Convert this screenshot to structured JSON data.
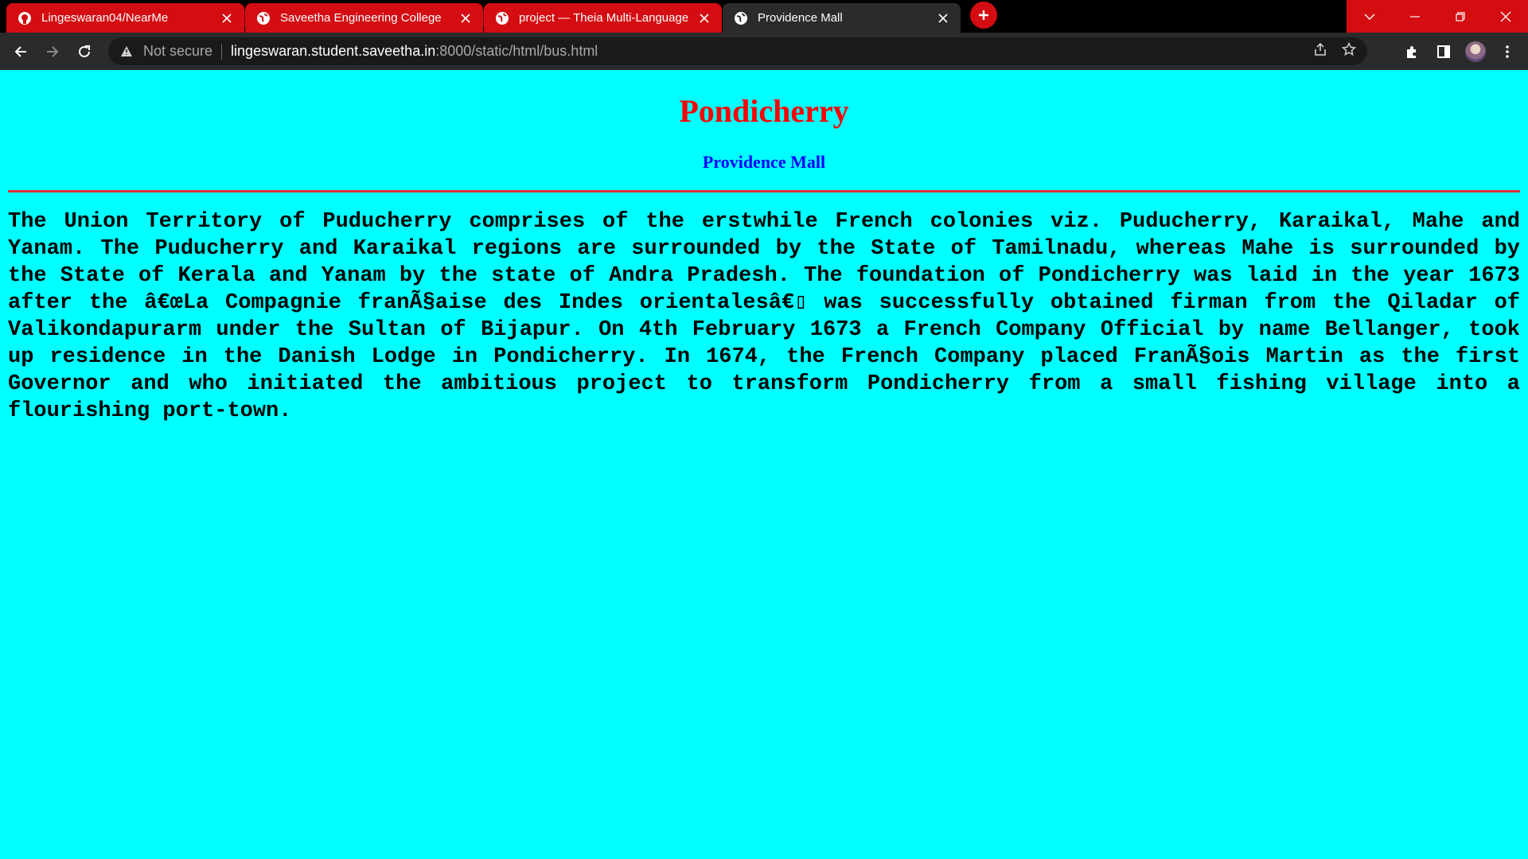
{
  "browser": {
    "tabs": [
      {
        "title": "Lingeswaran04/NearMe",
        "favicon": "github-icon",
        "active": false
      },
      {
        "title": "Saveetha Engineering College",
        "favicon": "globe-icon",
        "active": false
      },
      {
        "title": "project — Theia Multi-Language",
        "favicon": "globe-icon",
        "active": false
      },
      {
        "title": "Providence Mall",
        "favicon": "globe-icon",
        "active": true
      }
    ],
    "security_label": "Not secure",
    "url_host": "lingeswaran.student.saveetha.in",
    "url_rest": ":8000/static/html/bus.html",
    "colors": {
      "tabstrip": "#d40d12",
      "active_tab": "#2b2b2b",
      "page_bg": "#00ffff"
    }
  },
  "page": {
    "heading": "Pondicherry",
    "subheading": "Providence Mall",
    "body": "The Union Territory of Puducherry comprises of the erstwhile French colonies viz. Puducherry, Karaikal, Mahe and Yanam. The Puducherry and Karaikal regions are surrounded by the State of Tamilnadu, whereas Mahe is surrounded by the State of Kerala and Yanam by the state of Andra Pradesh. The foundation of Pondicherry was laid in the year 1673 after the â€œLa Compagnie franÃ§aise des Indes orientalesâ€▯ was successfully obtained firman from the Qiladar of Valikondapurarm under the Sultan of Bijapur. On 4th February 1673 a French Company Official by name Bellanger, took up residence in the Danish Lodge in Pondicherry. In 1674, the French Company placed FranÃ§ois Martin as the first Governor and who initiated the ambitious project to transform Pondicherry from a small fishing village into a flourishing port-town.",
    "colors": {
      "heading": "#ff0000",
      "subheading": "#0000ff",
      "rule": "#e03030",
      "text": "#000000"
    }
  }
}
